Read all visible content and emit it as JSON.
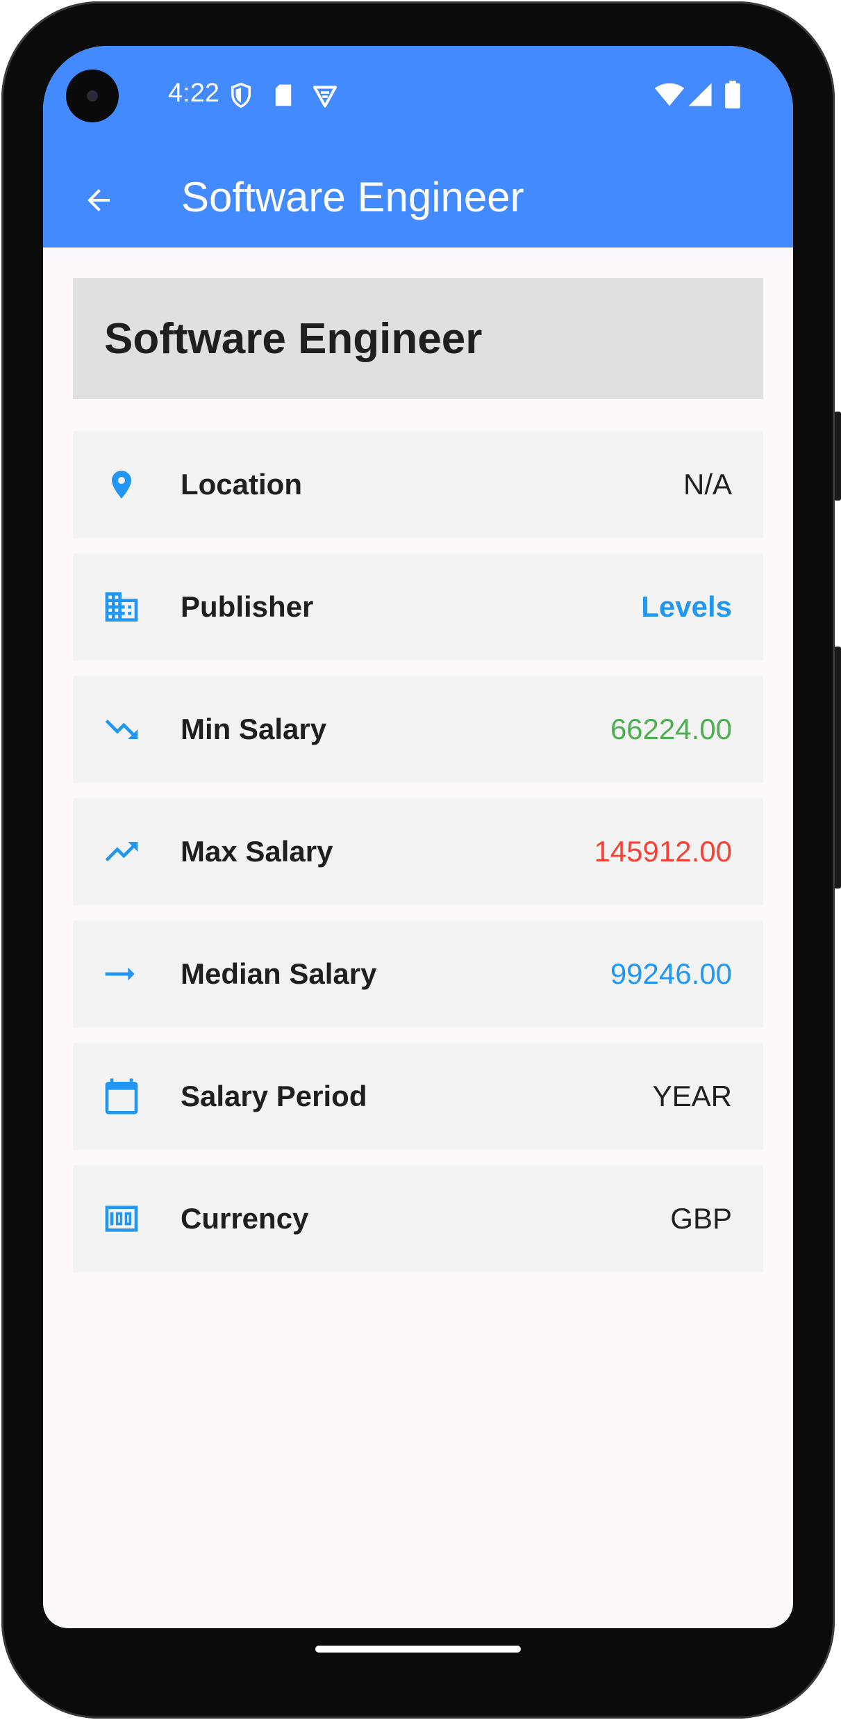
{
  "status_bar": {
    "time": "4:22",
    "left_icons": [
      "shield-icon",
      "sd-card-icon",
      "vpn-icon"
    ],
    "right_icons": [
      "wifi-icon",
      "cellular-signal-icon",
      "battery-icon"
    ]
  },
  "app_bar": {
    "title": "Software Engineer",
    "back_icon": "arrow-back-icon",
    "color": "#448aff"
  },
  "job": {
    "title": "Software Engineer"
  },
  "details": [
    {
      "key": "location",
      "icon": "location-pin-icon",
      "label": "Location",
      "value": "N/A",
      "value_color": "#212121"
    },
    {
      "key": "publisher",
      "icon": "building-icon",
      "label": "Publisher",
      "value": "Levels",
      "value_color": "#2196f3"
    },
    {
      "key": "min-salary",
      "icon": "trending-down-icon",
      "label": "Min Salary",
      "value": "66224.00",
      "value_color": "#4caf50"
    },
    {
      "key": "max-salary",
      "icon": "trending-up-icon",
      "label": "Max Salary",
      "value": "145912.00",
      "value_color": "#f44336"
    },
    {
      "key": "median-salary",
      "icon": "arrow-right-icon",
      "label": "Median Salary",
      "value": "99246.00",
      "value_color": "#2196f3"
    },
    {
      "key": "salary-period",
      "icon": "calendar-icon",
      "label": "Salary Period",
      "value": "YEAR",
      "value_color": "#212121"
    },
    {
      "key": "currency",
      "icon": "money-icon",
      "label": "Currency",
      "value": "GBP",
      "value_color": "#212121"
    }
  ],
  "colors": {
    "icon_blue": "#2196f3",
    "row_background": "#f3f3f3",
    "title_card_background": "#e0e0e0",
    "screen_background": "#fcf8fc"
  }
}
